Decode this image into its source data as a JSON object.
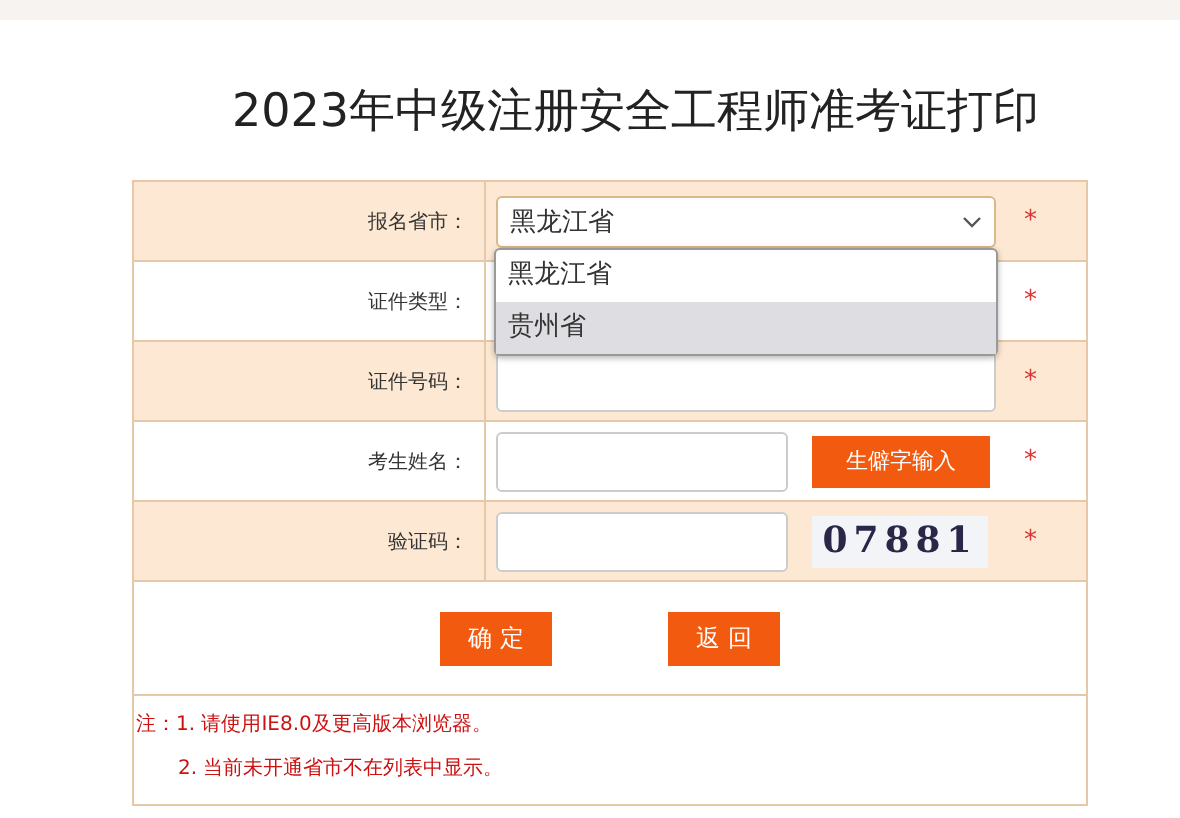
{
  "title": "2023年中级注册安全工程师准考证打印",
  "rows": [
    {
      "label": "报名省市：",
      "kind": "select",
      "value": "黑龙江省",
      "mark": "*"
    },
    {
      "label": "证件类型：",
      "kind": "hidden",
      "mark": "*"
    },
    {
      "label": "证件号码：",
      "kind": "input",
      "mark": "*"
    },
    {
      "label": "考生姓名：",
      "kind": "input_button",
      "button": "生僻字输入",
      "mark": "*"
    },
    {
      "label": "验证码：",
      "kind": "captcha",
      "captcha": "07881",
      "mark": "*"
    }
  ],
  "dropdown": {
    "options": [
      {
        "label": "黑龙江省",
        "selected": false
      },
      {
        "label": "贵州省",
        "selected": true
      }
    ]
  },
  "actions": [
    "确 定",
    "返 回"
  ],
  "notes": [
    "注：1. 请使用IE8.0及更高版本浏览器。",
    "2. 当前未开通省市不在列表中显示。"
  ]
}
